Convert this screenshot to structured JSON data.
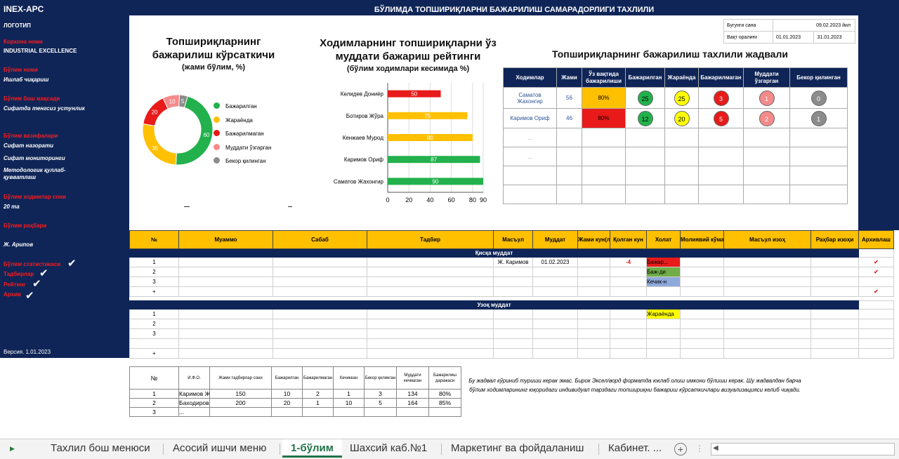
{
  "sidebar": {
    "title": "INEX-APC",
    "logo": "ЛОГОТИП",
    "company_label": "Корхона номи",
    "company": "INDUSTRIAL EXCELLENCE",
    "dept_label": "Бўлим номи",
    "dept": "Ишлаб чиқариш",
    "goal_label": "Бўлим бош мақсади",
    "goal": "Сифатда тенгсиз устунлик",
    "tasks_label": "Бўлим вазифалари",
    "task1": "Сифат назорати",
    "task2": "Сифат мониторинги",
    "task3a": "Методологик қуллаб-",
    "task3b": "қувватлаш",
    "staff_label": "Бўлим ходимлар сони",
    "staff": "20 та",
    "head_label": "Бўлим раҳбари",
    "head": "Ж. Арипов",
    "stat": "Бўлим статистикаси",
    "measures": "Тадбирлар",
    "rating": "Рейтинг",
    "archive": "Архив",
    "version": "Версия. 1.01.2023"
  },
  "header": {
    "title": "БЎЛИМДА ТОПШИРИҚЛАРНИ БАЖАРИЛИШ САМАРАДОРЛИГИ ТАХЛИЛИ",
    "today_label": "Бугунги сана",
    "today": "09.02.2023 йил",
    "interval_label": "Вақт оралиғи",
    "from": "01.01.2023",
    "to": "31.01.2023"
  },
  "donut": {
    "title1": "Топшириқларнинг",
    "title2": "бажарилиш кўрсаткичи",
    "subtitle": "(жами бўлим, %)",
    "legend": [
      "Бажарилган",
      "Жараёнда",
      "Бажарилмаган",
      "Муддати ўзгарган",
      "Бекор қилинган"
    ]
  },
  "bar": {
    "title1": "Ходимларнинг топшириқларни ўз",
    "title2": "муддати бажариш рейтинги",
    "subtitle": "(бўлим ходимлари кесимида %)"
  },
  "chart_data": [
    {
      "type": "pie",
      "labels": [
        "Бажарилган",
        "Жараёнда",
        "Бажарилмаган",
        "Муддати ўзгарган",
        "Бекор қилинган"
      ],
      "values": [
        60,
        35,
        20,
        10,
        5
      ],
      "colors": [
        "#22b14c",
        "#ffc000",
        "#e81a1a",
        "#f48a8a",
        "#8c8c8c"
      ]
    },
    {
      "type": "bar",
      "orientation": "horizontal",
      "categories": [
        "Келидев Дониёр",
        "Ботиров Жўра",
        "Кенжаев Мурод",
        "Каримов Ориф",
        "Саматов Жахонгир"
      ],
      "values": [
        50,
        75,
        80,
        87,
        90
      ],
      "colors": [
        "#e81a1a",
        "#ffc000",
        "#ffc000",
        "#22b14c",
        "#22b14c"
      ],
      "xlim": [
        0,
        90
      ],
      "xticks": [
        0,
        20,
        40,
        60,
        80,
        90
      ]
    }
  ],
  "analysis": {
    "title": "Топшириқларнинг бажарилиш тахлили жадвали",
    "cols": [
      "Ходимлар",
      "Жами",
      "Ўз вақтида бажарилиши",
      "Бажарилган",
      "Жараёнда",
      "Бажарилмаган",
      "Муддати ўзгарган",
      "Бекор қилинган"
    ],
    "rows": [
      {
        "name1": "Саматов",
        "name2": "Жахонгир",
        "total": "56",
        "pct": "80%",
        "done": "25",
        "prog": "25",
        "notdone": "3",
        "changed": "1",
        "cancel": "0"
      },
      {
        "name1": "Каримов Ориф",
        "name2": "",
        "total": "46",
        "pct": "80%",
        "done": "12",
        "prog": "20",
        "notdone": "5",
        "changed": "2",
        "cancel": "1"
      }
    ],
    "ellipsis": "...",
    "empty_rows": [
      "...",
      "...",
      "",
      ""
    ]
  },
  "main_table": {
    "cols": [
      "№",
      "Муаммо",
      "Сабаб",
      "Тадбир",
      "Масъул",
      "Муддат",
      "Жами кун(лар)",
      "Қолган кун",
      "Холат",
      "Молиявий кўмак",
      "Масъул изоҳ",
      "Раҳбар изоҳи",
      "Архивлаш"
    ],
    "short_label": "Қисқа муддат",
    "long_label": "Узоқ муддат",
    "short_rows": [
      {
        "n": "1",
        "resp": "Ж. Каримов",
        "date": "01.02.2023",
        "left": "-4",
        "status": "Бажар...",
        "status_color": "#e81a1a",
        "arch": "✔"
      },
      {
        "n": "2",
        "resp": "",
        "date": "",
        "left": "",
        "status": "Баж-ди",
        "status_color": "#70ad47",
        "arch": "✔"
      },
      {
        "n": "3",
        "resp": "",
        "date": "",
        "left": "",
        "status": "Кечик-н",
        "status_color": "#8ea9db",
        "arch": ""
      },
      {
        "n": "+",
        "resp": "",
        "date": "",
        "left": "",
        "status": "",
        "status_color": "",
        "arch": "✔"
      }
    ],
    "long_rows": [
      {
        "n": "1",
        "status": "Жараёнда",
        "status_color": "#ffff00"
      },
      {
        "n": "2",
        "status": "",
        "status_color": ""
      },
      {
        "n": "3",
        "status": "",
        "status_color": ""
      },
      {
        "n": "",
        "status": "",
        "status_color": ""
      },
      {
        "n": "+",
        "status": "",
        "status_color": ""
      }
    ]
  },
  "bottom_table": {
    "cols": [
      "№",
      "И.Ф.О.",
      "Жами тадбирлар сони",
      "Бажарилган",
      "Бажарилмаган",
      "Кечиккан",
      "Бекор қилинган",
      "Муддати кечмаган",
      "Бажарилиш даражаси"
    ],
    "rows": [
      [
        "1",
        "Каримов Ж",
        "150",
        "10",
        "2",
        "1",
        "3",
        "134",
        "80%"
      ],
      [
        "2",
        "Баходиров",
        "200",
        "20",
        "1",
        "10",
        "5",
        "164",
        "85%"
      ],
      [
        "3",
        "...",
        "",
        "",
        "",
        "",
        "",
        "",
        ""
      ]
    ]
  },
  "note": "Бу жадвал кўриниб туриши керак эмас. Бирок Эксел/ворд форматда юклаб олиш имкони бўлиши керак. Шу жадвалдан барча бўлим ходимларининг юқоридаги индивидуал тарздаги топшириқни бажариш кўрсаткичлари визуализацияси келиб чиқади.",
  "tabs": [
    "Тахлил бош менюси",
    "Асосий ишчи меню",
    "1-бўлим",
    "Шахсий каб.№1",
    "Маркетинг ва фойдаланиш",
    "Кабинет. ..."
  ]
}
